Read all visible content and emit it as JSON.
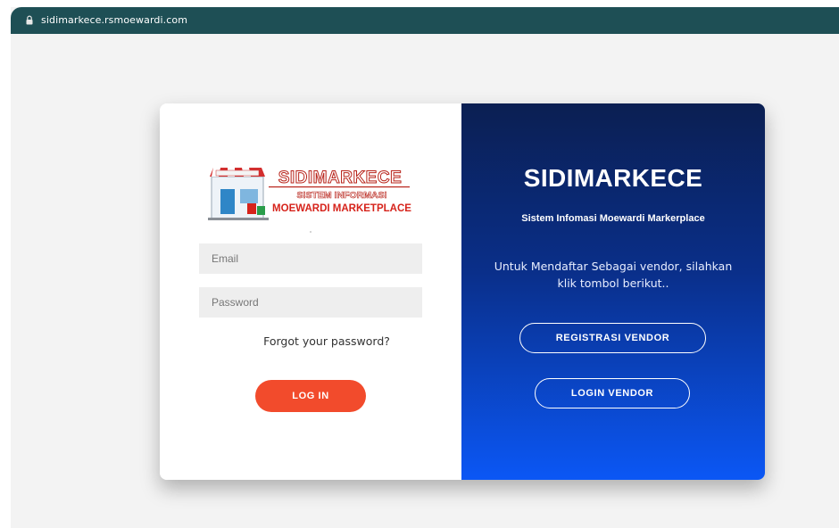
{
  "browser": {
    "url": "sidimarkece.rsmoewardi.com"
  },
  "logo": {
    "title": "SIDIMARKECE",
    "line1": "SISTEM INFORMASI",
    "line2": "MOEWARDI MARKETPLACE"
  },
  "login_form": {
    "email_placeholder": "Email",
    "password_placeholder": "Password",
    "forgot_label": "Forgot your password?",
    "login_label": "LOG IN"
  },
  "vendor_panel": {
    "title": "SIDIMARKECE",
    "subtitle": "Sistem Infomasi Moewardi Markerplace",
    "description": "Untuk Mendaftar Sebagai vendor, silahkan klik tombol berikut..",
    "register_label": "REGISTRASI VENDOR",
    "login_label": "LOGIN VENDOR"
  },
  "colors": {
    "urlbar": "#1e4f55",
    "accent_button": "#f24b2c",
    "panel_top": "#0b1f52",
    "panel_bottom": "#0b57f5"
  },
  "icons": {
    "lock": "lock-icon"
  }
}
